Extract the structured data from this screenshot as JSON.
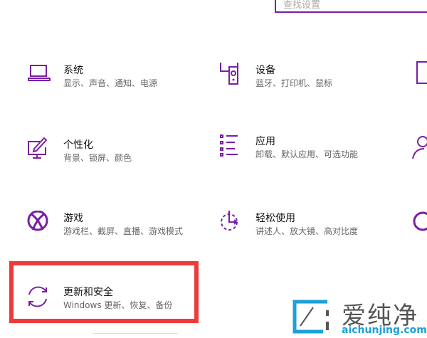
{
  "search": {
    "placeholder": "查找设置"
  },
  "accent": "#7a1fa2",
  "highlight_color": "#ee3a3a",
  "items": [
    {
      "title": "系统",
      "subtitle": "显示、声音、通知、电源",
      "icon": "laptop-icon"
    },
    {
      "title": "设备",
      "subtitle": "蓝牙、打印机、鼠标",
      "icon": "devices-icon"
    },
    {
      "title": "个性化",
      "subtitle": "背景、锁屏、颜色",
      "icon": "personalization-icon"
    },
    {
      "title": "应用",
      "subtitle": "卸载、默认应用、可选功能",
      "icon": "apps-list-icon"
    },
    {
      "title": "游戏",
      "subtitle": "游戏栏、截屏、直播、游戏模式",
      "icon": "xbox-icon"
    },
    {
      "title": "轻松使用",
      "subtitle": "讲述人、放大镜、高对比度",
      "icon": "ease-of-access-icon"
    },
    {
      "title": "更新和安全",
      "subtitle": "Windows 更新、恢复、备份",
      "icon": "sync-icon"
    }
  ],
  "watermark": {
    "cn": "爱纯净",
    "en": "aichunjing.com"
  }
}
